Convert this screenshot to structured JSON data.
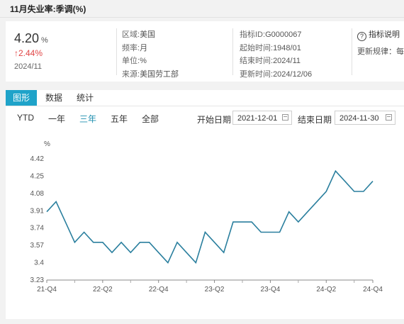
{
  "window": {
    "title": "11月失业率:季调(%)"
  },
  "summary": {
    "value": "4.20",
    "unit": "%",
    "change": "↑2.44%",
    "period": "2024/11"
  },
  "meta_left": [
    {
      "key": "区域:",
      "value": "美国"
    },
    {
      "key": "频率:",
      "value": "月"
    },
    {
      "key": "单位:",
      "value": "%"
    },
    {
      "key": "来源:",
      "value": "美国劳工部"
    }
  ],
  "meta_right": [
    {
      "key": "指标ID:",
      "value": "G0000067"
    },
    {
      "key": "起始时间:",
      "value": "1948/01"
    },
    {
      "key": "结束时间:",
      "value": "2024/11"
    },
    {
      "key": "更新时间:",
      "value": "2024/12/06"
    }
  ],
  "help": {
    "label": "指标说明",
    "rule": "更新规律：每"
  },
  "tabs": [
    {
      "label": "图形",
      "active": true
    },
    {
      "label": "数据",
      "active": false
    },
    {
      "label": "统计",
      "active": false
    }
  ],
  "ranges": [
    {
      "label": "YTD",
      "active": false
    },
    {
      "label": "一年",
      "active": false
    },
    {
      "label": "三年",
      "active": true
    },
    {
      "label": "五年",
      "active": false
    },
    {
      "label": "全部",
      "active": false
    }
  ],
  "date_filter": {
    "start_label": "开始日期",
    "start_value": "2021-12-01",
    "end_label": "结束日期",
    "end_value": "2024-11-30"
  },
  "chart_data": {
    "type": "line",
    "ylabel": "%",
    "ylim": [
      3.23,
      4.42
    ],
    "y_ticks": [
      "4.42",
      "4.25",
      "4.08",
      "3.91",
      "3.74",
      "3.57",
      "3.4",
      "3.23"
    ],
    "x_ticks": [
      "21-Q4",
      "22-Q2",
      "22-Q4",
      "23-Q2",
      "23-Q4",
      "24-Q2",
      "24-Q4"
    ],
    "x": [
      "2021-12",
      "2022-01",
      "2022-02",
      "2022-03",
      "2022-04",
      "2022-05",
      "2022-06",
      "2022-07",
      "2022-08",
      "2022-09",
      "2022-10",
      "2022-11",
      "2022-12",
      "2023-01",
      "2023-02",
      "2023-03",
      "2023-04",
      "2023-05",
      "2023-06",
      "2023-07",
      "2023-08",
      "2023-09",
      "2023-10",
      "2023-11",
      "2023-12",
      "2024-01",
      "2024-02",
      "2024-03",
      "2024-04",
      "2024-05",
      "2024-06",
      "2024-07",
      "2024-08",
      "2024-09",
      "2024-10",
      "2024-11"
    ],
    "values": [
      3.9,
      4.0,
      3.8,
      3.6,
      3.7,
      3.6,
      3.6,
      3.5,
      3.6,
      3.5,
      3.6,
      3.6,
      3.5,
      3.4,
      3.6,
      3.5,
      3.4,
      3.7,
      3.6,
      3.5,
      3.8,
      3.8,
      3.8,
      3.7,
      3.7,
      3.7,
      3.9,
      3.8,
      3.9,
      4.0,
      4.1,
      4.3,
      4.2,
      4.1,
      4.1,
      4.2
    ],
    "series_color": "#2a7f9e",
    "grid": false
  }
}
